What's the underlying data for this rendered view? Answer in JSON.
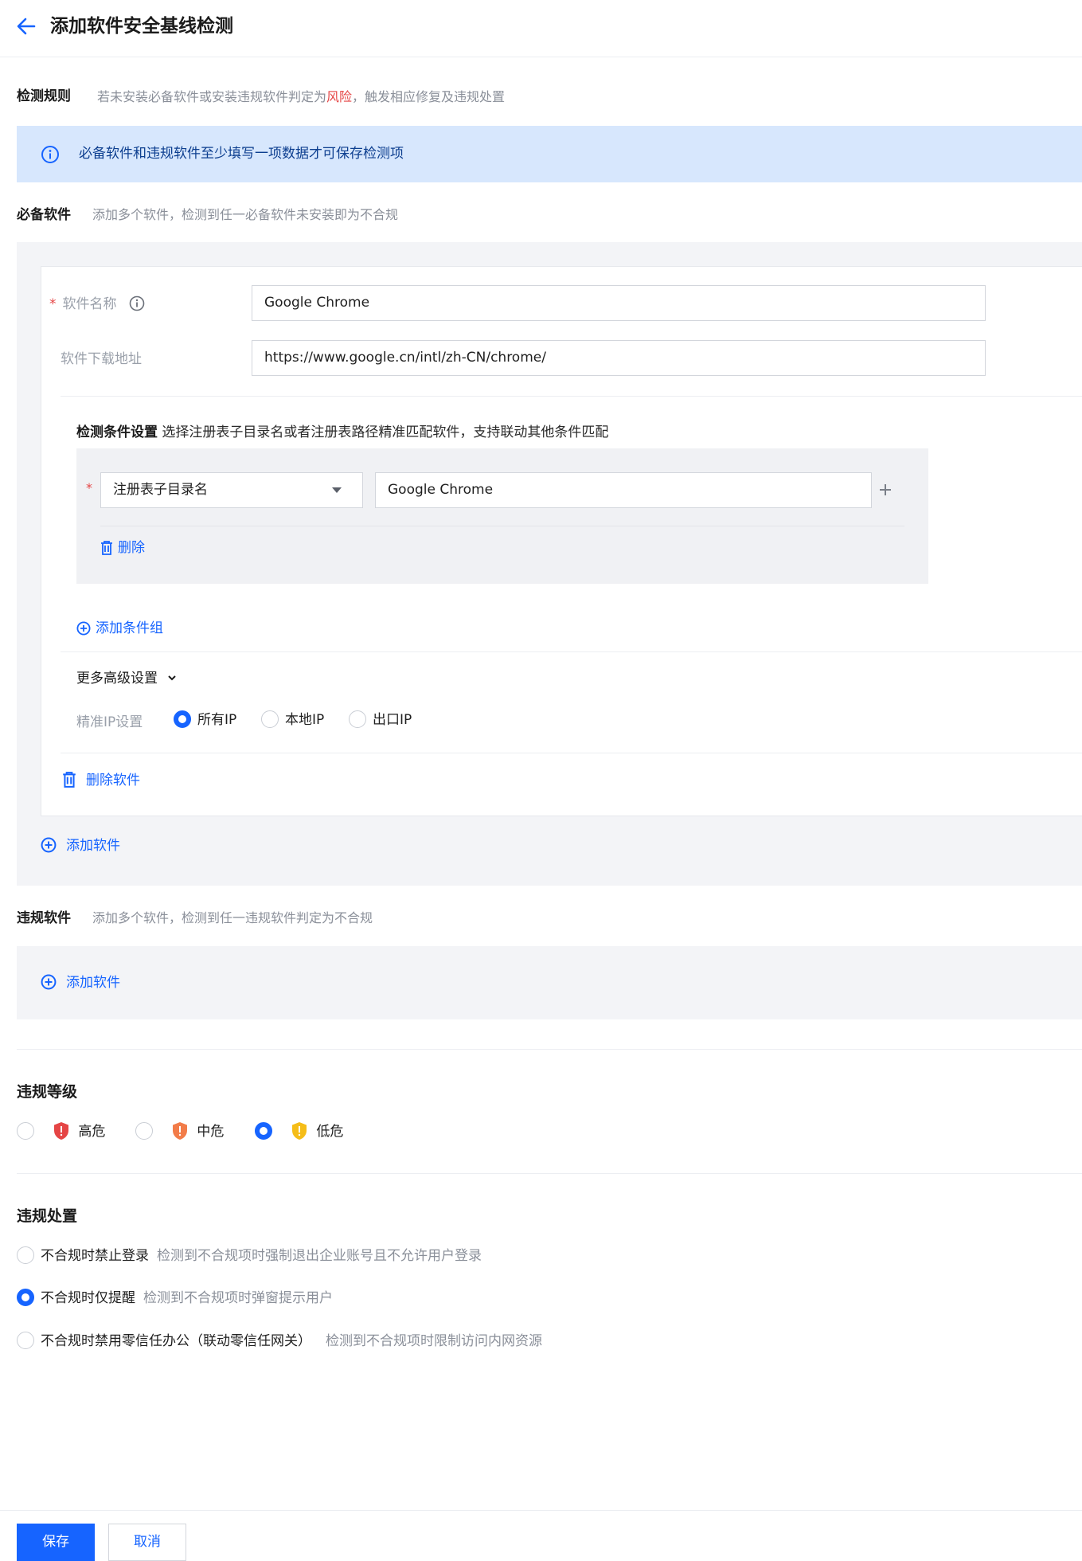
{
  "header": {
    "title": "添加软件安全基线检测"
  },
  "rule": {
    "title": "检测规则",
    "desc_prefix": "若未安装必备软件或安装违规软件判定为",
    "desc_risk": "风险",
    "desc_suffix": "，触发相应修复及违规处置",
    "risk_color": "#e54545"
  },
  "banner": {
    "text": "必备软件和违规软件至少填写一项数据才可保存检测项"
  },
  "required": {
    "title": "必备软件",
    "desc": "添加多个软件，检测到任一必备软件未安装即为不合规",
    "software": {
      "name_label": "软件名称",
      "name_value": "Google Chrome",
      "url_label": "软件下载地址",
      "url_value": "https://www.google.cn/intl/zh-CN/chrome/",
      "condition_title": "检测条件设置",
      "condition_desc": "选择注册表子目录名或者注册表路径精准匹配软件，支持联动其他条件匹配",
      "condition_type": "注册表子目录名",
      "condition_value": "Google Chrome",
      "delete_label": "删除",
      "add_group_label": "添加条件组",
      "advanced_label": "更多高级设置",
      "ip_label": "精准IP设置",
      "ip_options": [
        "所有IP",
        "本地IP",
        "出口IP"
      ],
      "ip_selected": "所有IP",
      "delete_software_label": "删除软件"
    },
    "add_label": "添加软件"
  },
  "violation_software": {
    "title": "违规软件",
    "desc": "添加多个软件，检测到任一违规软件判定为不合规",
    "add_label": "添加软件"
  },
  "level": {
    "title": "违规等级",
    "options": [
      {
        "label": "高危",
        "color": "#e54545"
      },
      {
        "label": "中危",
        "color": "#f27c49"
      },
      {
        "label": "低危",
        "color": "#f5bd18"
      }
    ],
    "selected": "低危"
  },
  "disposal": {
    "title": "违规处置",
    "options": [
      {
        "label": "不合规时禁止登录",
        "desc": "检测到不合规项时强制退出企业账号且不允许用户登录"
      },
      {
        "label": "不合规时仅提醒",
        "desc": "检测到不合规项时弹窗提示用户"
      },
      {
        "label": "不合规时禁用零信任办公（联动零信任网关）",
        "desc": "检测到不合规项时限制访问内网资源"
      }
    ],
    "selected": "不合规时仅提醒"
  },
  "footer": {
    "save_label": "保存",
    "cancel_label": "取消"
  },
  "accent_color": "#1664ff"
}
